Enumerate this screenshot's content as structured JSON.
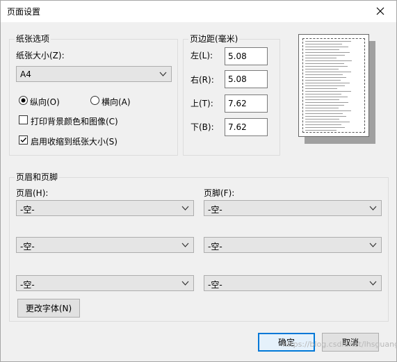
{
  "window": {
    "title": "页面设置"
  },
  "paper": {
    "group_title": "纸张选项",
    "size_label": "纸张大小(Z):",
    "size_value": "A4",
    "orientation_portrait": "纵向(O)",
    "orientation_landscape": "横向(A)",
    "orientation_selected": "portrait",
    "print_background": "打印背景颜色和图像(C)",
    "print_background_checked": false,
    "shrink_to_fit": "启用收缩到纸张大小(S)",
    "shrink_to_fit_checked": true
  },
  "margins": {
    "group_title": "页边距(毫米)",
    "left_label": "左(L):",
    "left_value": "5.08",
    "right_label": "右(R):",
    "right_value": "5.08",
    "top_label": "上(T):",
    "top_value": "7.62",
    "bottom_label": "下(B):",
    "bottom_value": "7.62"
  },
  "header_footer": {
    "group_title": "页眉和页脚",
    "header_label": "页眉(H):",
    "footer_label": "页脚(F):",
    "header_values": [
      "-空-",
      "-空-",
      "-空-"
    ],
    "footer_values": [
      "-空-",
      "-空-",
      "-空-"
    ],
    "change_font_button": "更改字体(N)"
  },
  "buttons": {
    "ok": "确定",
    "cancel": "取消"
  },
  "watermark": "https://blog.csdn.net/lhsguang",
  "colors": {
    "accent": "#0078d7"
  }
}
